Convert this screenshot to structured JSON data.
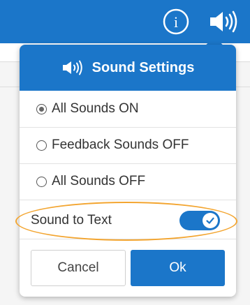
{
  "colors": {
    "primary": "#1b76c9",
    "highlight": "#f3a530",
    "text": "#333333"
  },
  "topbar": {
    "info_icon": "info-icon",
    "sound_icon": "speaker-icon"
  },
  "dialog": {
    "title": "Sound Settings",
    "title_icon": "speaker-icon",
    "options": [
      {
        "label": "All Sounds ON",
        "selected": true
      },
      {
        "label": "Feedback Sounds OFF",
        "selected": false
      },
      {
        "label": "All Sounds OFF",
        "selected": false
      }
    ],
    "sound_to_text": {
      "label": "Sound to Text",
      "enabled": true
    },
    "cancel_label": "Cancel",
    "ok_label": "Ok"
  }
}
